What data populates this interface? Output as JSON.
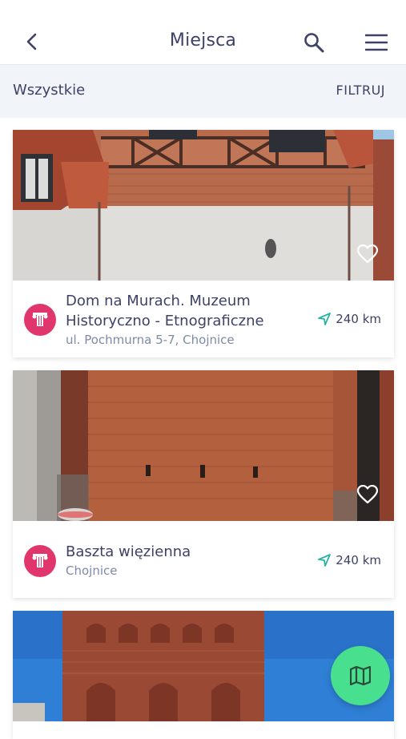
{
  "header": {
    "title": "Miejsca",
    "icons": {
      "back": "chevron-left-icon",
      "search": "search-icon",
      "menu": "hamburger-menu-icon"
    }
  },
  "filterbar": {
    "all_label": "Wszystkie",
    "filter_label": "FILTRUJ"
  },
  "places": [
    {
      "name_line1": "Dom na Murach. Muzeum",
      "name_line2": "Historyczno - Etnograficzne",
      "address": "ul. Pochmurna 5-7,  Chojnice",
      "distance": "240 km",
      "category_icon": "column-icon",
      "favorite_icon": "heart-outline-icon"
    },
    {
      "name_line1": "Baszta więzienna",
      "address": "Chojnice",
      "distance": "240 km",
      "category_icon": "column-icon",
      "favorite_icon": "heart-outline-icon"
    }
  ],
  "fab": {
    "icon": "map-icon"
  },
  "colors": {
    "accent_pink": "#e0366b",
    "accent_green": "#48e08f",
    "text_primary": "#3d4266",
    "text_secondary": "#7e8aa6",
    "nav_teal": "#2bb3a6",
    "filterbar_bg": "#f1f5f9"
  }
}
